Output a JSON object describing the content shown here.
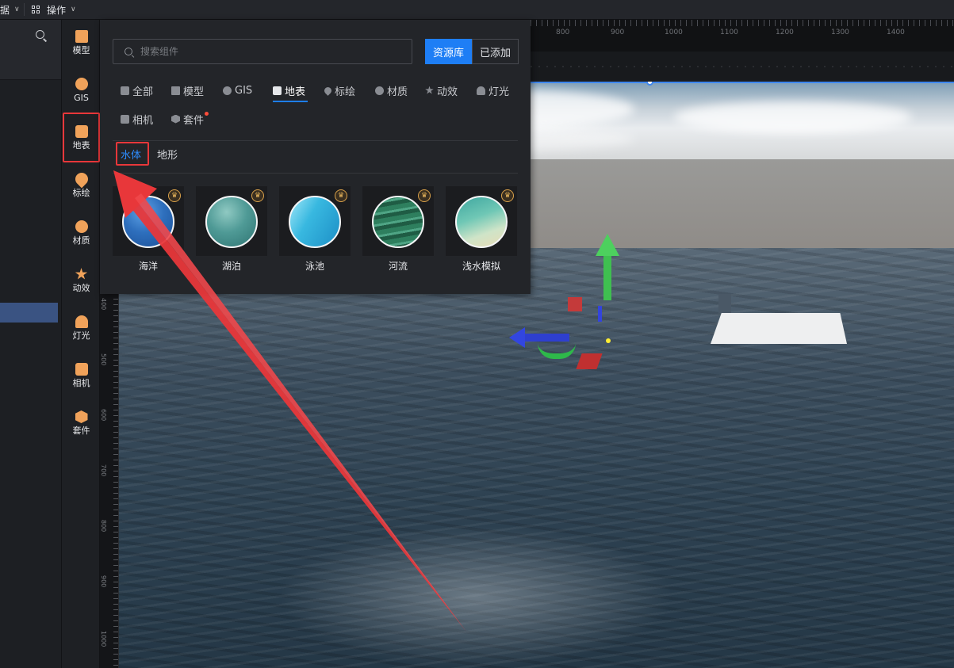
{
  "topbar": {
    "menu_partial_label": "据",
    "ops_label": "操作"
  },
  "rail": {
    "items": [
      {
        "label": "模型",
        "icon": "model-icon"
      },
      {
        "label": "GIS",
        "icon": "gis-icon"
      },
      {
        "label": "地表",
        "icon": "surface-icon"
      },
      {
        "label": "标绘",
        "icon": "marker-icon"
      },
      {
        "label": "材质",
        "icon": "material-icon"
      },
      {
        "label": "动效",
        "icon": "effect-icon"
      },
      {
        "label": "灯光",
        "icon": "light-icon"
      },
      {
        "label": "相机",
        "icon": "camera-icon"
      },
      {
        "label": "套件",
        "icon": "kit-icon"
      }
    ],
    "active_index": 2
  },
  "panel": {
    "search_placeholder": "搜索组件",
    "btn_library": "资源库",
    "btn_added": "已添加",
    "categories": [
      {
        "label": "全部",
        "icon": "all-icon"
      },
      {
        "label": "模型",
        "icon": "model-icon"
      },
      {
        "label": "GIS",
        "icon": "gis-icon"
      },
      {
        "label": "地表",
        "icon": "surface-icon"
      },
      {
        "label": "标绘",
        "icon": "marker-icon"
      },
      {
        "label": "材质",
        "icon": "material-icon"
      },
      {
        "label": "动效",
        "icon": "effect-icon"
      },
      {
        "label": "灯光",
        "icon": "light-icon"
      },
      {
        "label": "相机",
        "icon": "camera-icon"
      },
      {
        "label": "套件",
        "icon": "kit-icon"
      }
    ],
    "active_category": "地表",
    "subtabs": [
      "水体",
      "地形"
    ],
    "active_subtab": "水体",
    "cards": [
      {
        "label": "海洋",
        "thumb_color": "#2e6fbd"
      },
      {
        "label": "湖泊",
        "thumb_color": "#4f9a96"
      },
      {
        "label": "泳池",
        "thumb_color": "#38b8e0"
      },
      {
        "label": "河流",
        "thumb_color": "#2e7f5e"
      },
      {
        "label": "浅水模拟",
        "thumb_color": "#6fc7b5"
      }
    ]
  },
  "rulers": {
    "top_labels": [
      "800",
      "900",
      "1000",
      "1100",
      "1200",
      "1300",
      "1400"
    ],
    "left_labels": [
      "400",
      "500",
      "600",
      "700",
      "800",
      "900",
      "1000"
    ]
  },
  "colors": {
    "accent_blue": "#1e7ef5",
    "highlight_red": "#e8373a",
    "rail_icon": "#f0a25a"
  }
}
